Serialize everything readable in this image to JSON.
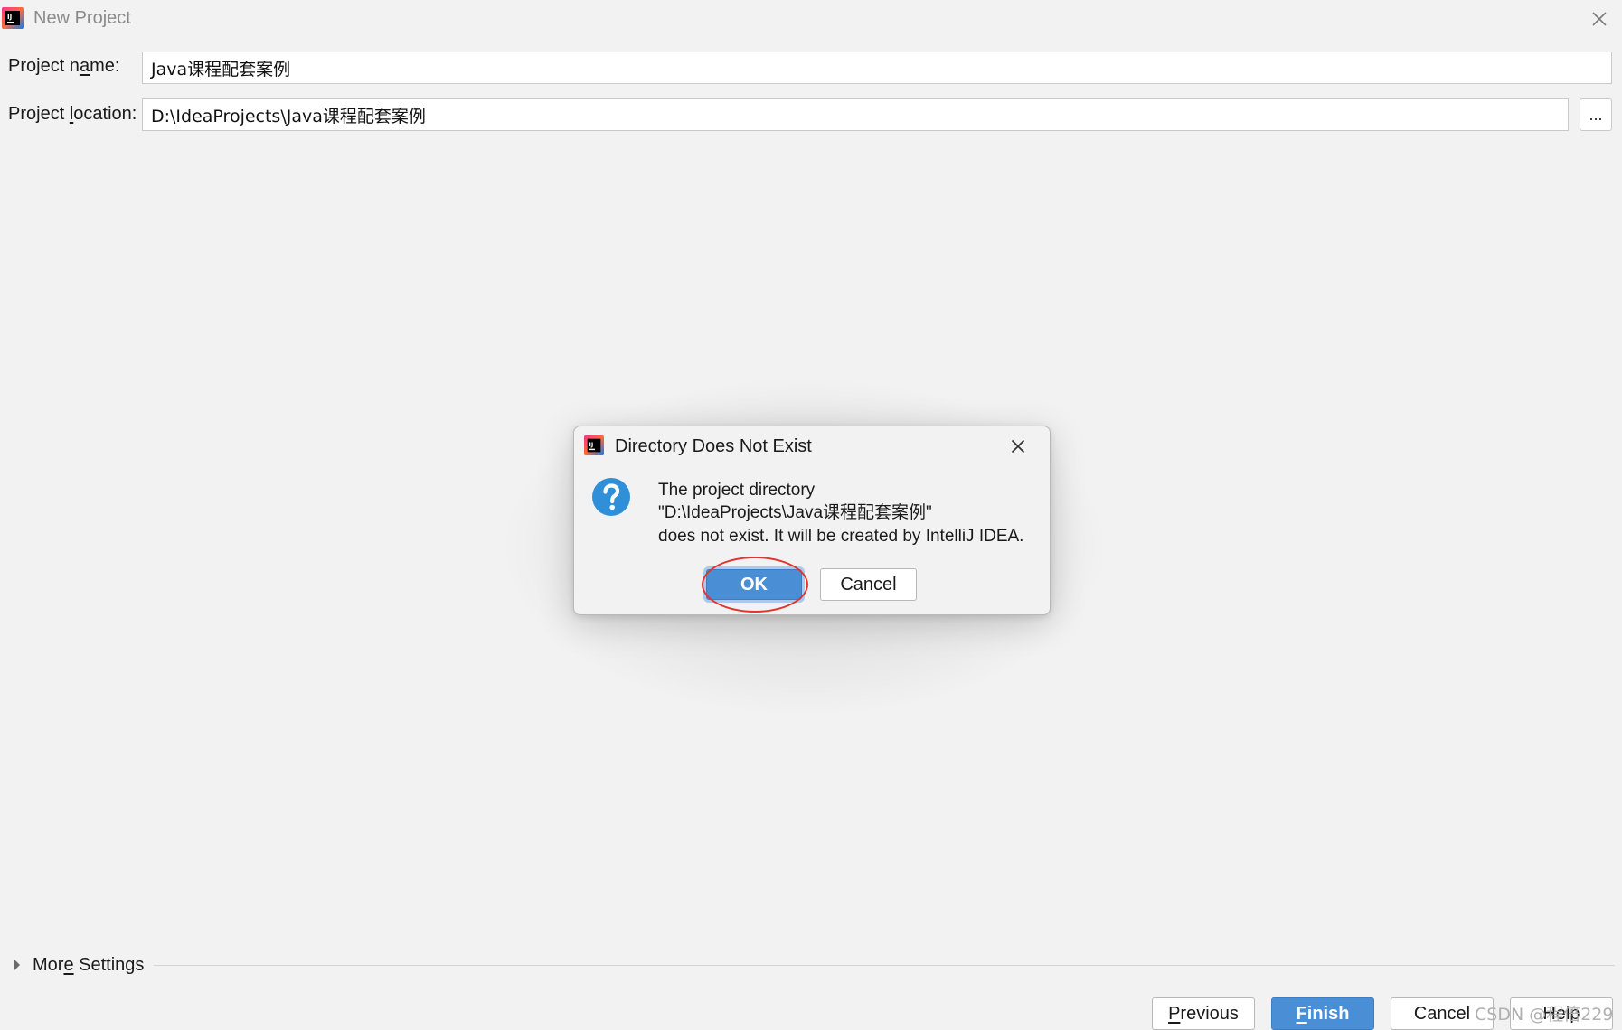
{
  "window": {
    "title": "New Project"
  },
  "form": {
    "project_name": {
      "label_before": "Project n",
      "label_mnemonic": "a",
      "label_after": "me:",
      "value": "Java课程配套案例"
    },
    "project_location": {
      "label_before": "Project ",
      "label_mnemonic": "l",
      "label_after": "ocation:",
      "value": "D:\\IdeaProjects\\Java课程配套案例",
      "browse_label": "..."
    }
  },
  "dialog": {
    "title": "Directory Does Not Exist",
    "message_line1": "The project directory",
    "message_line2": "\"D:\\IdeaProjects\\Java课程配套案例\"",
    "message_line3": "does not exist. It will be created by IntelliJ IDEA.",
    "ok_label": "OK",
    "cancel_label": "Cancel",
    "icon": "question-icon"
  },
  "more_settings": {
    "label_before": "Mor",
    "label_mnemonic": "e",
    "label_after": " Settings"
  },
  "footer": {
    "previous_mnemonic": "P",
    "previous_rest": "revious",
    "finish_mnemonic": "F",
    "finish_rest": "inish",
    "cancel_label": "Cancel",
    "help_label": "Help"
  },
  "watermark": "CSDN @程倍229",
  "colors": {
    "background": "#f2f2f2",
    "primary": "#4a8fd6",
    "annotation": "#e0352b",
    "question_icon": "#2f8fd8"
  }
}
